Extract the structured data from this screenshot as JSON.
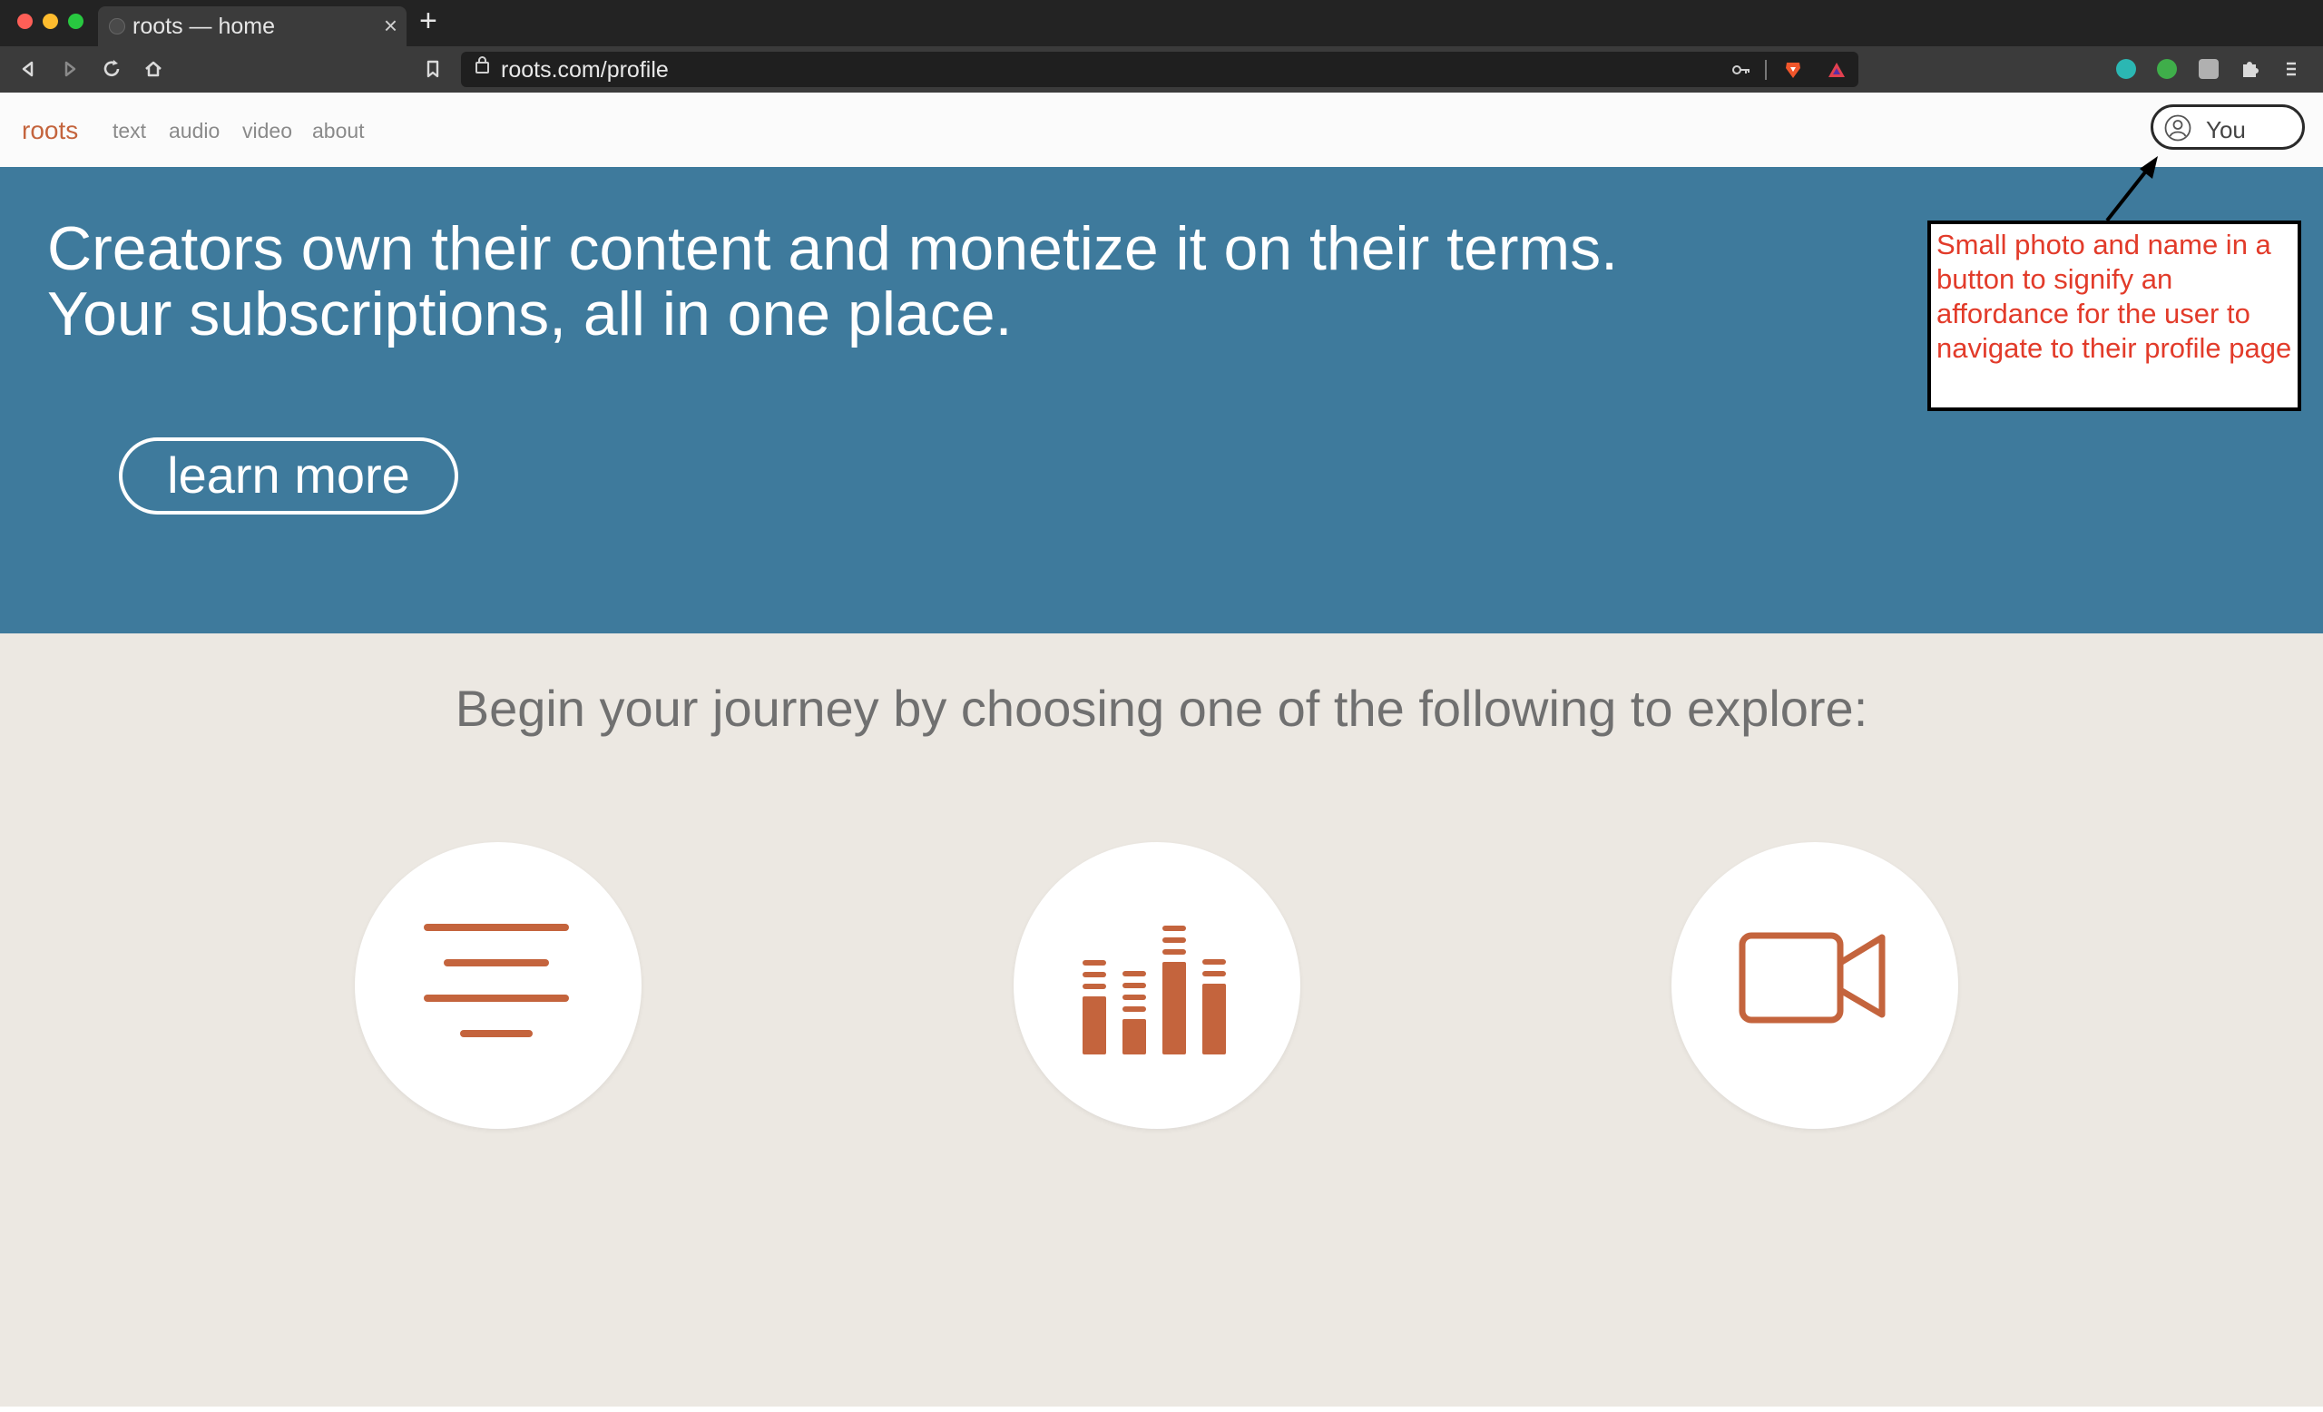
{
  "browser": {
    "tab_title": "roots — home",
    "tab_close": "×",
    "new_tab": "+",
    "url": "roots.com/profile"
  },
  "nav": {
    "logo": "roots",
    "links": [
      "text",
      "audio",
      "video",
      "about"
    ],
    "profile_button_label": "You"
  },
  "hero": {
    "line1": "Creators own their content and monetize it on their terms.",
    "line2": "Your subscriptions, all in one place.",
    "cta_label": "learn more"
  },
  "annotation": {
    "text": "Small photo and name in a button to signify an affordance for the user to  navigate to their profile page"
  },
  "explore": {
    "heading": "Begin your journey by choosing one of the following to explore:",
    "options": [
      {
        "icon": "text-lines-icon"
      },
      {
        "icon": "audio-equalizer-icon"
      },
      {
        "icon": "video-camera-icon"
      }
    ]
  },
  "colors": {
    "brand": "#c4643d",
    "hero_bg": "#3e7a9c",
    "explore_bg": "#ece8e2",
    "annotation_text": "#e23b2a"
  }
}
